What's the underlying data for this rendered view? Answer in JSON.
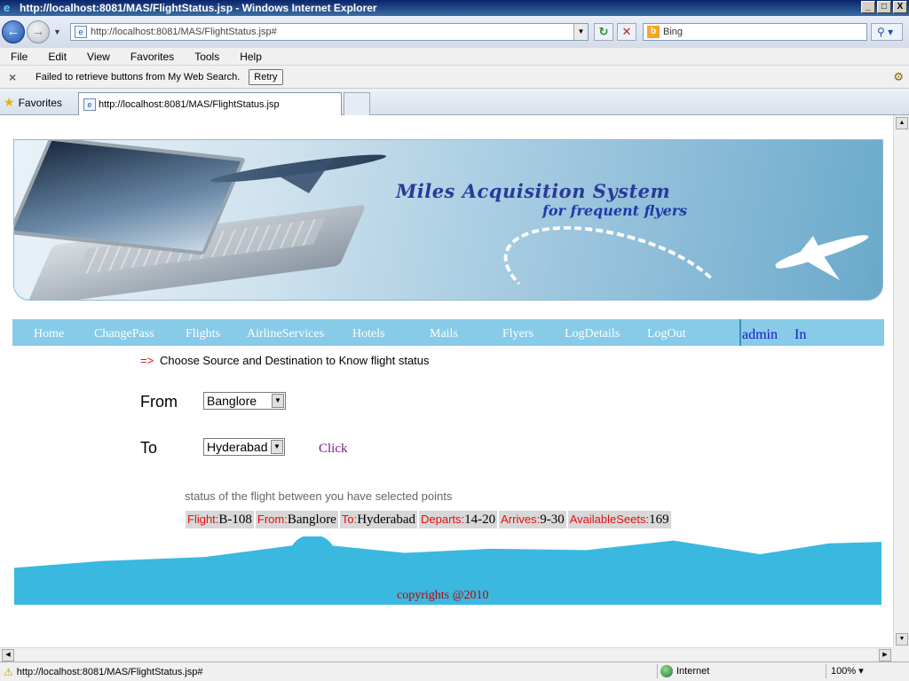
{
  "window": {
    "title": "http://localhost:8081/MAS/FlightStatus.jsp - Windows Internet Explorer",
    "min": "_",
    "max": "□",
    "close": "X"
  },
  "addressbar": {
    "url": "http://localhost:8081/MAS/FlightStatus.jsp#",
    "search_text": "Bing"
  },
  "menubar": {
    "items": [
      "File",
      "Edit",
      "View",
      "Favorites",
      "Tools",
      "Help"
    ]
  },
  "notification": {
    "message": "Failed to retrieve buttons from My Web Search.",
    "retry_label": "Retry"
  },
  "favorites": {
    "label": "Favorites",
    "tab_title": "http://localhost:8081/MAS/FlightStatus.jsp"
  },
  "banner": {
    "title": "Miles Acquisition System",
    "subtitle": "for frequent flyers"
  },
  "nav": {
    "items": [
      "Home",
      "ChangePass",
      "Flights",
      "AirlineServices",
      "Hotels",
      "Mails",
      "Flyers",
      "LogDetails",
      "LogOut"
    ],
    "user": "admin",
    "state": "In"
  },
  "form": {
    "arrow": "=>",
    "instruction": "Choose Source and Destination to Know flight status",
    "from_label": "From",
    "from_value": "Banglore",
    "to_label": "To",
    "to_value": "Hyderabad",
    "click_label": "Click"
  },
  "result": {
    "title": "status of the flight between you have selected points",
    "flight_label": "Flight:",
    "flight": "B-108",
    "from_label": "From:",
    "from": "Banglore",
    "to_label": "To:",
    "to": "Hyderabad",
    "departs_label": "Departs:",
    "departs": "14-20",
    "arrives_label": "Arrives:",
    "arrives": "9-30",
    "seats_label": "AvailableSeets:",
    "seats": "169"
  },
  "footer": {
    "copyright": "copyrights @2010"
  },
  "statusbar": {
    "url": "http://localhost:8081/MAS/FlightStatus.jsp#",
    "zone": "Internet",
    "zoom": "100%"
  }
}
